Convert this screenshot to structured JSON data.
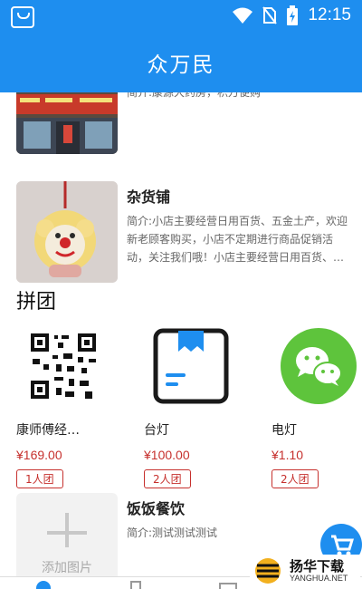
{
  "status_bar": {
    "time": "12:15"
  },
  "app": {
    "title": "众万民"
  },
  "stores": [
    {
      "name": "",
      "desc": "简介:康源大药房，积万便购"
    },
    {
      "name": "杂货铺",
      "desc": "简介:小店主要经营日用百货、五金土产，欢迎新老顾客购买，小店不定期进行商品促销活动，关注我们哦！小店主要经营日用百货、…"
    },
    {
      "name": "饭饭餐饮",
      "desc": "简介:测试测试测试",
      "image_placeholder": "添加图片"
    }
  ],
  "group_section": {
    "title": "拼团",
    "items": [
      {
        "name": "康师傅经…",
        "price": "¥169.00",
        "tag": "1人团"
      },
      {
        "name": "台灯",
        "price": "¥100.00",
        "tag": "2人团"
      },
      {
        "name": "电灯",
        "price": "¥1.10",
        "tag": "2人团"
      }
    ]
  },
  "watermark": {
    "title": "扬华下载",
    "subtitle": "YANGHUA.NET"
  },
  "colors": {
    "primary": "#1e8eef",
    "price": "#c6302d",
    "wechat": "#5ec43c"
  }
}
